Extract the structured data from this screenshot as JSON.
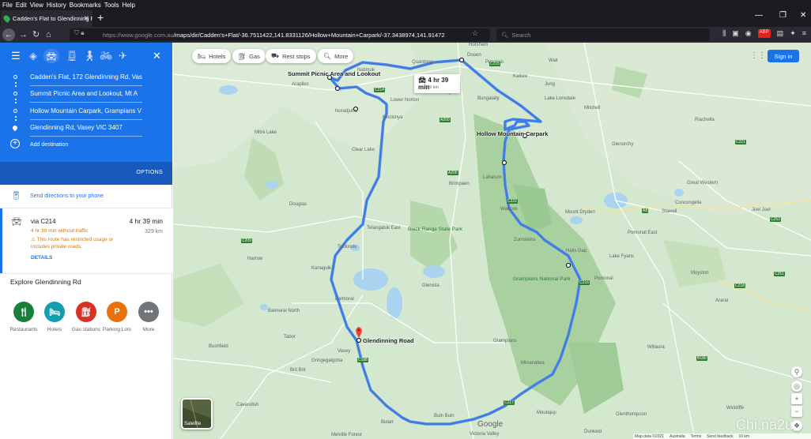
{
  "browser": {
    "menu": [
      "File",
      "Edit",
      "View",
      "History",
      "Bookmarks",
      "Tools",
      "Help"
    ],
    "tab_title": "Cadden's Flat to Glendinning R...",
    "url_host": "https://www.google.com.au",
    "url_path": "/maps/dir/Cadden's+Flat/-36.7511422,141.8331126/Hollow+Mountain+Carpark/-37.3438974,141.91472",
    "search_placeholder": "Search"
  },
  "panel": {
    "stops": [
      "Cadden's Flat, 172 Glendinning Rd, Vas",
      "Summit Picnic Area and Lookout, Mt A",
      "Hollow Mountain Carpark, Grampians V",
      "Glendinning Rd, Vasey VIC 3407"
    ],
    "add_destination": "Add destination",
    "options": "OPTIONS",
    "send": "Send directions to your phone",
    "route": {
      "via": "via C214",
      "time": "4 hr 39 min",
      "distance": "329 km",
      "without_traffic": "4 hr 39 min without traffic",
      "warning": "This route has restricted usage or includes private roads.",
      "details": "DETAILS"
    },
    "explore_title": "Explore Glendinning Rd",
    "categories": [
      {
        "label": "Restaurants",
        "icon": "restaurant-icon",
        "color": "#188038"
      },
      {
        "label": "Hotels",
        "icon": "hotel-icon",
        "color": "#129eaf"
      },
      {
        "label": "Gas stations",
        "icon": "gas-station-icon",
        "color": "#d93025"
      },
      {
        "label": "Parking Lots",
        "icon": "parking-icon",
        "color": "#e8710a"
      },
      {
        "label": "More",
        "icon": "more-icon",
        "color": "#70757a"
      }
    ]
  },
  "map": {
    "chips": [
      "Hotels",
      "Gas",
      "Rest stops",
      "More"
    ],
    "sign_in": "Sign in",
    "route_box": {
      "time": "4 hr 39 min",
      "distance": "329 km"
    },
    "places": {
      "summit": "Summit Picnic Area and Lookout",
      "hollow": "Hollow Mountain Carpark",
      "glendinning": "Glendinning Road"
    },
    "parks": {
      "black_range": "Black Range State Park",
      "grampians": "Grampians National Park"
    },
    "towns": [
      "Natimuk",
      "Horsham",
      "Toolondo",
      "Balmoral",
      "Harrow",
      "Stawell",
      "Halls Gap",
      "Dunkeld",
      "Cavendish",
      "Douglas",
      "Laharum",
      "Wartook",
      "Zumsteins",
      "Brimpaen",
      "Telangatuk East",
      "Mirranatwa",
      "Glenisla",
      "Melville Forest",
      "Buln Buln",
      "Kanagulk",
      "Vasey",
      "Gringegalgona",
      "Clear Lake",
      "Mitre Lake",
      "Noradjuha",
      "Arapiles",
      "Grampians",
      "Willaura",
      "Moyston",
      "Pomonal",
      "Concongella",
      "Joel Joel",
      "Great Western",
      "Ararat",
      "Mount Dryden",
      "Riachella",
      "Glenorchy",
      "Dooen",
      "Pimpinio",
      "Wail",
      "Mockinya",
      "Drung",
      "Bungalally",
      "Jung",
      "Lower Norton",
      "Mitchell",
      "Quantong",
      "Kalkee",
      "Lake Lonsdale",
      "Glenthompson",
      "Tabor",
      "Bulart",
      "Victoria Valley",
      "Balmoral North",
      "Brit Brit",
      "Bushfield",
      "Lake Fyans",
      "Pomonal East",
      "Moutajup",
      "Wickliffe"
    ],
    "roads": [
      "C215",
      "C214",
      "A200",
      "A206",
      "C222",
      "C216",
      "C217",
      "C188",
      "A8",
      "B180",
      "C221",
      "C253",
      "C218",
      "C251",
      "C209"
    ],
    "bottom": [
      "Map data ©2021",
      "Australia",
      "Terms",
      "Send feedback",
      "10 km"
    ],
    "satellite": "Satellite",
    "logo": "Google",
    "watermark": "Chi.na2u"
  }
}
